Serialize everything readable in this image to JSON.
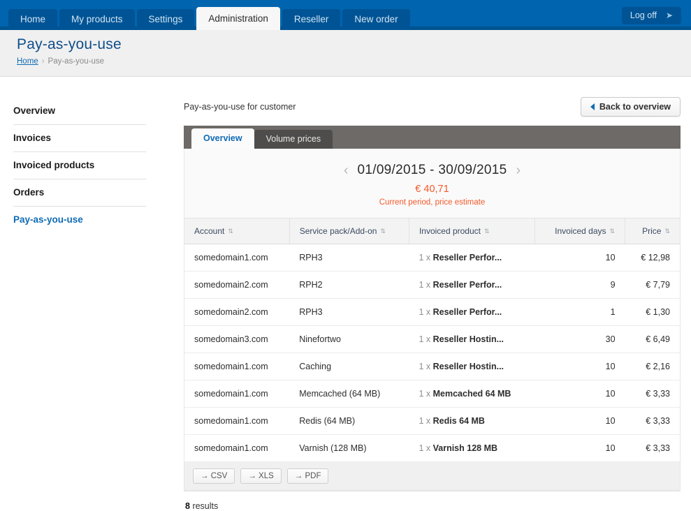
{
  "topnav": {
    "tabs": [
      {
        "label": "Home",
        "active": false
      },
      {
        "label": "My products",
        "active": false
      },
      {
        "label": "Settings",
        "active": false
      },
      {
        "label": "Administration",
        "active": true
      },
      {
        "label": "Reseller",
        "active": false
      },
      {
        "label": "New order",
        "active": false
      }
    ],
    "logoff_label": "Log off",
    "logoff_icon": "arrow-right-icon",
    "bg_color": "#0064ae"
  },
  "header": {
    "title": "Pay-as-you-use",
    "breadcrumb": {
      "home": "Home",
      "separator": "›",
      "current": "Pay-as-you-use"
    }
  },
  "sidebar": {
    "items": [
      {
        "label": "Overview",
        "active": false
      },
      {
        "label": "Invoices",
        "active": false
      },
      {
        "label": "Invoiced products",
        "active": false
      },
      {
        "label": "Orders",
        "active": false
      },
      {
        "label": "Pay-as-you-use",
        "active": true
      }
    ]
  },
  "main": {
    "subtitle": "Pay-as-you-use for customer",
    "back_button": {
      "label": "Back to overview",
      "icon": "triangle-left-icon"
    },
    "tabs": [
      {
        "label": "Overview",
        "active": true
      },
      {
        "label": "Volume prices",
        "active": false
      }
    ],
    "summary": {
      "prev_icon": "chevron-left-icon",
      "next_icon": "chevron-right-icon",
      "period": "01/09/2015 - 30/09/2015",
      "amount": "€ 40,71",
      "note": "Current period, price estimate",
      "accent_color": "#f4592a"
    },
    "table": {
      "columns": [
        {
          "label": "Account",
          "align": "left",
          "sortable": true
        },
        {
          "label": "Service pack/Add-on",
          "align": "left",
          "sortable": true
        },
        {
          "label": "Invoiced product",
          "align": "left",
          "sortable": true
        },
        {
          "label": "Invoiced days",
          "align": "right",
          "sortable": true
        },
        {
          "label": "Price",
          "align": "right",
          "sortable": true
        }
      ],
      "sort_icon": "⇅",
      "rows": [
        {
          "account": "somedomain1.com",
          "service": "RPH3",
          "qty": "1 x",
          "product": "Reseller Perfor...",
          "days": "10",
          "price": "€ 12,98"
        },
        {
          "account": "somedomain2.com",
          "service": "RPH2",
          "qty": "1 x",
          "product": "Reseller Perfor...",
          "days": "9",
          "price": "€ 7,79"
        },
        {
          "account": "somedomain2.com",
          "service": "RPH3",
          "qty": "1 x",
          "product": "Reseller Perfor...",
          "days": "1",
          "price": "€ 1,30"
        },
        {
          "account": "somedomain3.com",
          "service": "Ninefortwo",
          "qty": "1 x",
          "product": "Reseller Hostin...",
          "days": "30",
          "price": "€ 6,49"
        },
        {
          "account": "somedomain1.com",
          "service": "Caching",
          "qty": "1 x",
          "product": "Reseller Hostin...",
          "days": "10",
          "price": "€ 2,16"
        },
        {
          "account": "somedomain1.com",
          "service": "Memcached (64 MB)",
          "qty": "1 x",
          "product": "Memcached 64 MB",
          "days": "10",
          "price": "€ 3,33"
        },
        {
          "account": "somedomain1.com",
          "service": "Redis (64 MB)",
          "qty": "1 x",
          "product": "Redis 64 MB",
          "days": "10",
          "price": "€ 3,33"
        },
        {
          "account": "somedomain1.com",
          "service": "Varnish (128 MB)",
          "qty": "1 x",
          "product": "Varnish 128 MB",
          "days": "10",
          "price": "€ 3,33"
        }
      ]
    },
    "exports": [
      {
        "label": "→ CSV"
      },
      {
        "label": "→ XLS"
      },
      {
        "label": "→ PDF"
      }
    ],
    "results_count": "8",
    "results_label": "results"
  }
}
